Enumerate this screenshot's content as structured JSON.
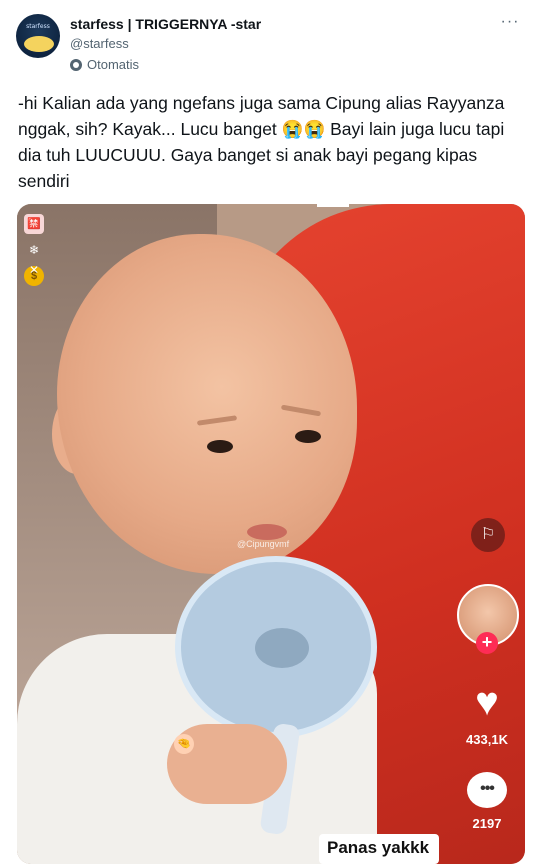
{
  "header": {
    "display_name": "starfess | TRIGGERNYA -star",
    "handle": "@starfess",
    "more_label": "···",
    "audience_label": "Otomatis",
    "avatar_text": "starfess"
  },
  "tweet": {
    "text": "-hi Kalian ada yang ngefans juga sama Cipung alias Rayyanza nggak, sih? Kayak... Lucu banget 😭😭 Bayi lain juga lucu tapi dia tuh LUUCUUU. Gaya banget si anak bayi pegang kipas sendiri"
  },
  "media": {
    "watermark": "@Cipungvmf",
    "left_icons": [
      "🈲",
      "❄ ✕",
      "🤏",
      "$"
    ],
    "flag_icon": "⚐",
    "follow_plus": "+",
    "heart_icon": "♥",
    "like_count": "433,1K",
    "comment_icon": "•••",
    "comment_count": "2197",
    "caption": "Panas yakkk"
  },
  "colors": {
    "text": "#0f1419",
    "secondary": "#536471",
    "tiktok_red": "#fe2c55"
  }
}
